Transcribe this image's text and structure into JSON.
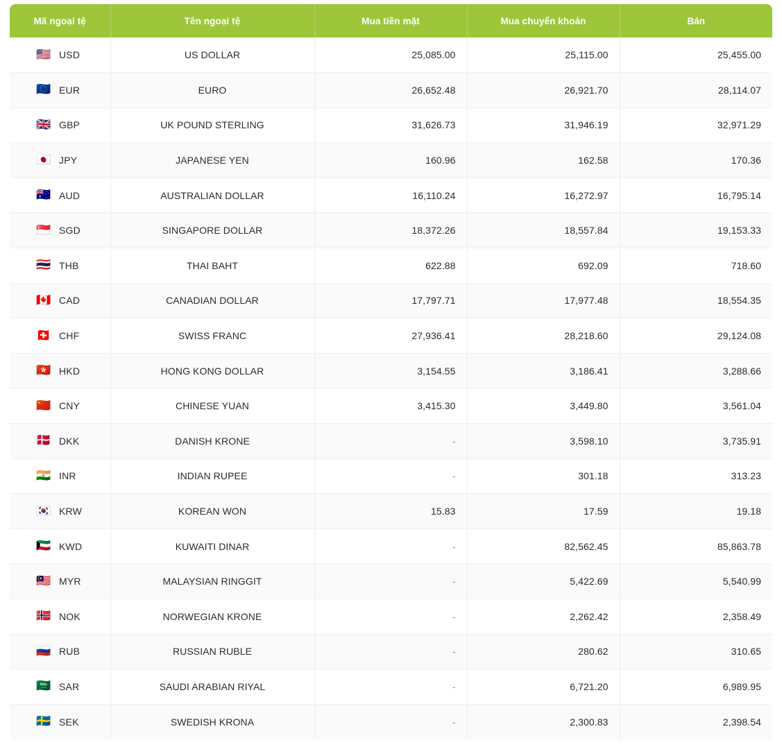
{
  "table": {
    "name": "exchange-rate-table",
    "columns": [
      {
        "key": "code",
        "label": "Mã ngoại tệ",
        "align": "left"
      },
      {
        "key": "name",
        "label": "Tên ngoại tệ",
        "align": "center"
      },
      {
        "key": "cash_buy",
        "label": "Mua tiền mặt",
        "align": "right"
      },
      {
        "key": "transfer",
        "label": "Mua chuyển khoản",
        "align": "right"
      },
      {
        "key": "sell",
        "label": "Bán",
        "align": "right"
      }
    ],
    "empty_value": "-",
    "header_color": "#9dc63b",
    "header_divider_color": "#b6d472",
    "header_text_color": "#ffffff",
    "row_alt_color": "#fafafa",
    "row_base_color": "#ffffff",
    "row_border_color": "#f0f0f0",
    "rows": [
      {
        "flag": "🇺🇸",
        "flag_name": "flag-us",
        "code": "USD",
        "name": "US DOLLAR",
        "cash_buy": "25,085.00",
        "transfer": "25,115.00",
        "sell": "25,455.00"
      },
      {
        "flag": "🇪🇺",
        "flag_name": "flag-eu",
        "code": "EUR",
        "name": "EURO",
        "cash_buy": "26,652.48",
        "transfer": "26,921.70",
        "sell": "28,114.07"
      },
      {
        "flag": "🇬🇧",
        "flag_name": "flag-gb",
        "code": "GBP",
        "name": "UK POUND STERLING",
        "cash_buy": "31,626.73",
        "transfer": "31,946.19",
        "sell": "32,971.29"
      },
      {
        "flag": "🇯🇵",
        "flag_name": "flag-jp",
        "code": "JPY",
        "name": "JAPANESE YEN",
        "cash_buy": "160.96",
        "transfer": "162.58",
        "sell": "170.36"
      },
      {
        "flag": "🇦🇺",
        "flag_name": "flag-au",
        "code": "AUD",
        "name": "AUSTRALIAN DOLLAR",
        "cash_buy": "16,110.24",
        "transfer": "16,272.97",
        "sell": "16,795.14"
      },
      {
        "flag": "🇸🇬",
        "flag_name": "flag-sg",
        "code": "SGD",
        "name": "SINGAPORE DOLLAR",
        "cash_buy": "18,372.26",
        "transfer": "18,557.84",
        "sell": "19,153.33"
      },
      {
        "flag": "🇹🇭",
        "flag_name": "flag-th",
        "code": "THB",
        "name": "THAI BAHT",
        "cash_buy": "622.88",
        "transfer": "692.09",
        "sell": "718.60"
      },
      {
        "flag": "🇨🇦",
        "flag_name": "flag-ca",
        "code": "CAD",
        "name": "CANADIAN DOLLAR",
        "cash_buy": "17,797.71",
        "transfer": "17,977.48",
        "sell": "18,554.35"
      },
      {
        "flag": "🇨🇭",
        "flag_name": "flag-ch",
        "code": "CHF",
        "name": "SWISS FRANC",
        "cash_buy": "27,936.41",
        "transfer": "28,218.60",
        "sell": "29,124.08"
      },
      {
        "flag": "🇭🇰",
        "flag_name": "flag-hk",
        "code": "HKD",
        "name": "HONG KONG DOLLAR",
        "cash_buy": "3,154.55",
        "transfer": "3,186.41",
        "sell": "3,288.66"
      },
      {
        "flag": "🇨🇳",
        "flag_name": "flag-cn",
        "code": "CNY",
        "name": "CHINESE YUAN",
        "cash_buy": "3,415.30",
        "transfer": "3,449.80",
        "sell": "3,561.04"
      },
      {
        "flag": "🇩🇰",
        "flag_name": "flag-dk",
        "code": "DKK",
        "name": "DANISH KRONE",
        "cash_buy": "-",
        "transfer": "3,598.10",
        "sell": "3,735.91"
      },
      {
        "flag": "🇮🇳",
        "flag_name": "flag-in",
        "code": "INR",
        "name": "INDIAN RUPEE",
        "cash_buy": "-",
        "transfer": "301.18",
        "sell": "313.23"
      },
      {
        "flag": "🇰🇷",
        "flag_name": "flag-kr",
        "code": "KRW",
        "name": "KOREAN WON",
        "cash_buy": "15.83",
        "transfer": "17.59",
        "sell": "19.18"
      },
      {
        "flag": "🇰🇼",
        "flag_name": "flag-kw",
        "code": "KWD",
        "name": "KUWAITI DINAR",
        "cash_buy": "-",
        "transfer": "82,562.45",
        "sell": "85,863.78"
      },
      {
        "flag": "🇲🇾",
        "flag_name": "flag-my",
        "code": "MYR",
        "name": "MALAYSIAN RINGGIT",
        "cash_buy": "-",
        "transfer": "5,422.69",
        "sell": "5,540.99"
      },
      {
        "flag": "🇳🇴",
        "flag_name": "flag-no",
        "code": "NOK",
        "name": "NORWEGIAN KRONE",
        "cash_buy": "-",
        "transfer": "2,262.42",
        "sell": "2,358.49"
      },
      {
        "flag": "🇷🇺",
        "flag_name": "flag-ru",
        "code": "RUB",
        "name": "RUSSIAN RUBLE",
        "cash_buy": "-",
        "transfer": "280.62",
        "sell": "310.65"
      },
      {
        "flag": "🇸🇦",
        "flag_name": "flag-sa",
        "code": "SAR",
        "name": "SAUDI ARABIAN RIYAL",
        "cash_buy": "-",
        "transfer": "6,721.20",
        "sell": "6,989.95"
      },
      {
        "flag": "🇸🇪",
        "flag_name": "flag-se",
        "code": "SEK",
        "name": "SWEDISH KRONA",
        "cash_buy": "-",
        "transfer": "2,300.83",
        "sell": "2,398.54"
      }
    ]
  }
}
